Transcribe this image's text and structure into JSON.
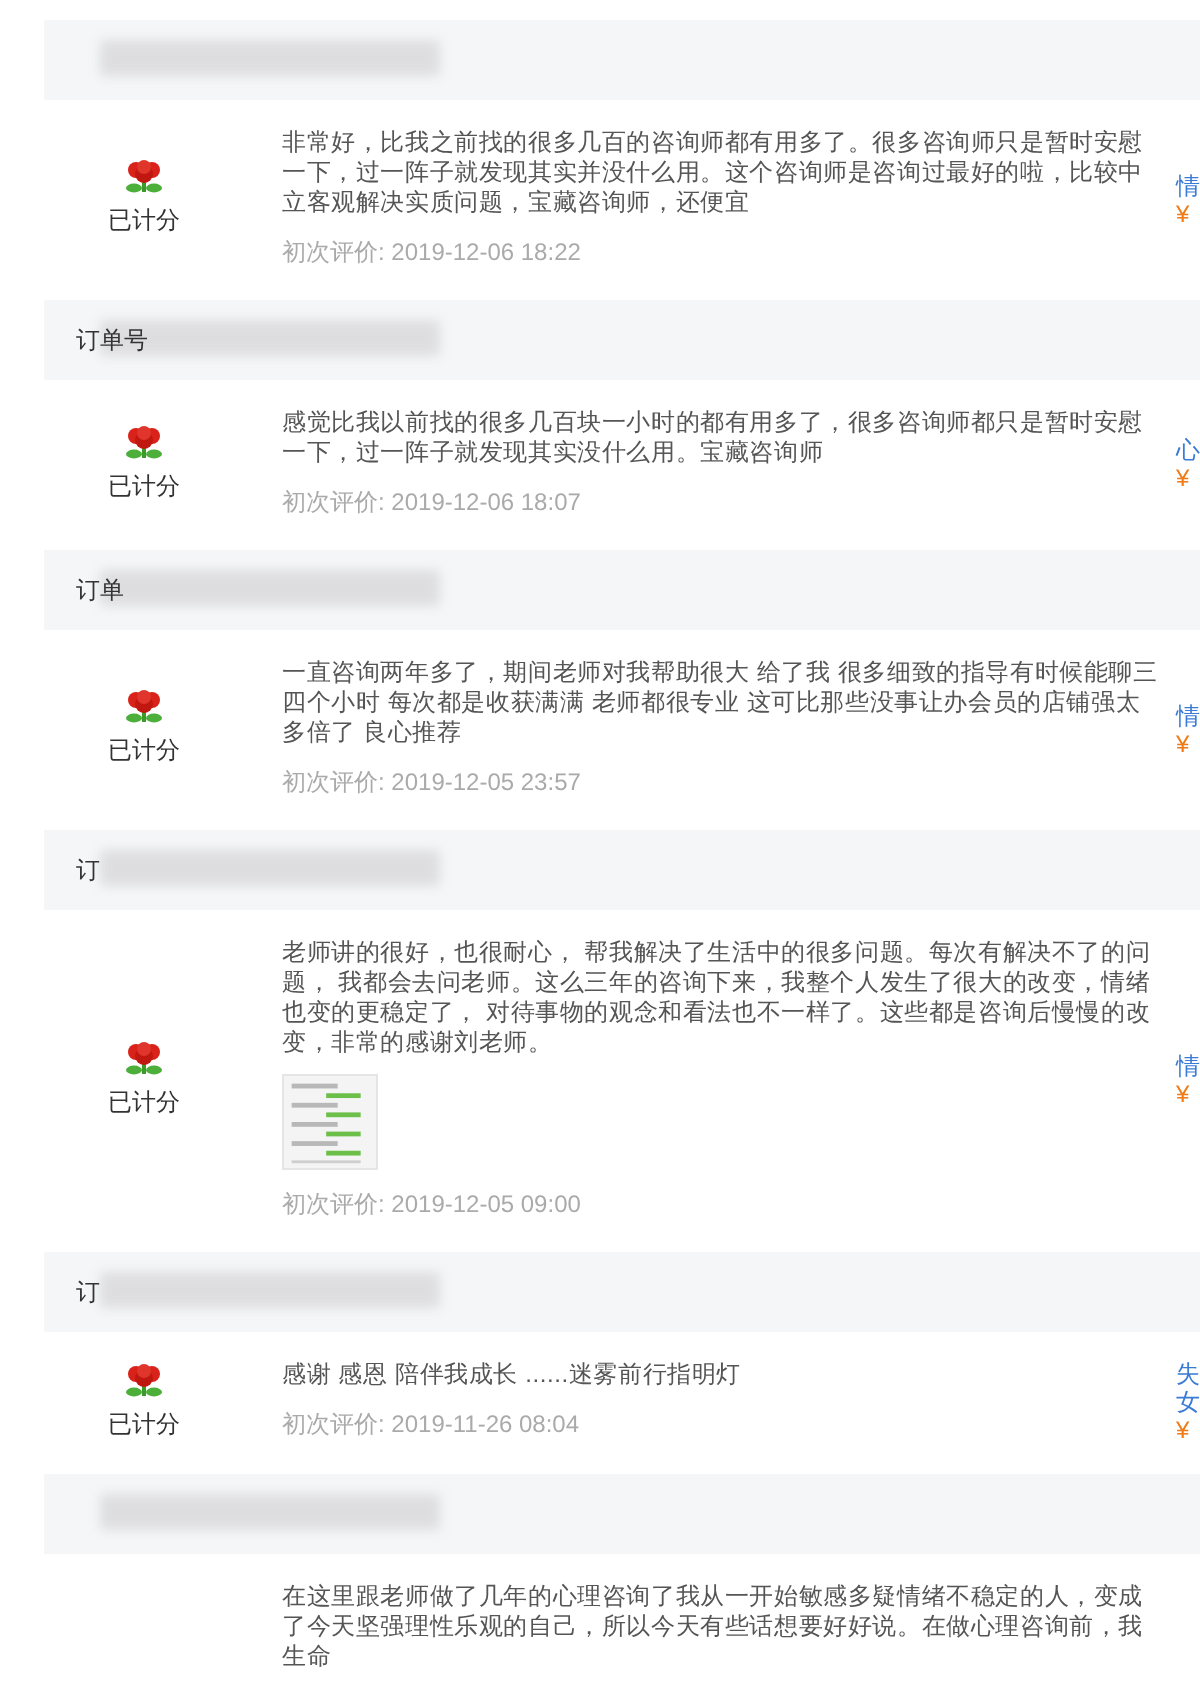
{
  "reviews": [
    {
      "status": "已计分",
      "text": "非常好，比我之前找的很多几百的咨询师都有用多了。很多咨询师只是暂时安慰一下，过一阵子就发现其实并没什么用。这个咨询师是咨询过最好的啦，比较中立客观解决实质问题，宝藏咨询师，还便宜",
      "has_image": false,
      "date": "初次评价: 2019-12-06 18:22",
      "side": [
        "情",
        "¥"
      ]
    },
    {
      "order_label": "订单号",
      "status": "已计分",
      "text": "感觉比我以前找的很多几百块一小时的都有用多了，很多咨询师都只是暂时安慰一下，过一阵子就发现其实没什么用。宝藏咨询师",
      "has_image": false,
      "date": "初次评价: 2019-12-06 18:07",
      "side": [
        "心",
        "¥"
      ]
    },
    {
      "order_label": "订单",
      "status": "已计分",
      "text": "一直咨询两年多了，期间老师对我帮助很大 给了我 很多细致的指导有时候能聊三四个小时 每次都是收获满满 老师都很专业 这可比那些没事让办会员的店铺强太多倍了 良心推荐",
      "has_image": false,
      "date": "初次评价: 2019-12-05 23:57",
      "side": [
        "情",
        "¥"
      ]
    },
    {
      "order_label": "订",
      "status": "已计分",
      "text": "老师讲的很好，也很耐心， 帮我解决了生活中的很多问题。每次有解决不了的问题， 我都会去问老师。这么三年的咨询下来，我整个人发生了很大的改变，情绪也变的更稳定了， 对待事物的观念和看法也不一样了。这些都是咨询后慢慢的改变，非常的感谢刘老师。",
      "has_image": true,
      "date": "初次评价: 2019-12-05 09:00",
      "side": [
        "情",
        "¥"
      ]
    },
    {
      "order_label": "订",
      "status": "已计分",
      "text": "感谢 感恩 陪伴我成长 ......迷雾前行指明灯",
      "has_image": false,
      "date": "初次评价: 2019-11-26 08:04",
      "side": [
        "失",
        "女",
        "¥"
      ]
    },
    {
      "text": "在这里跟老师做了几年的心理咨询了我从一开始敏感多疑情绪不稳定的人，变成了今天坚强理性乐观的自己，所以今天有些话想要好好说。在做心理咨询前，我生命",
      "has_image": false
    }
  ]
}
